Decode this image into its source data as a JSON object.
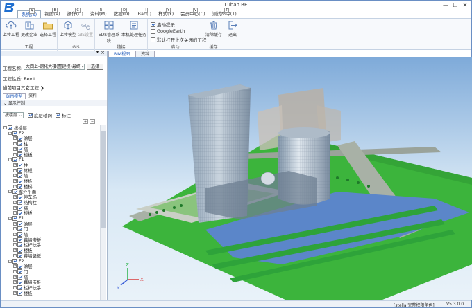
{
  "window": {
    "title": "Luban BE",
    "minimize": "—",
    "maximize": "☐",
    "close": "✕"
  },
  "menu": [
    {
      "label": "系统(S)",
      "key": "A",
      "active": true
    },
    {
      "label": "视图(V)",
      "key": "B"
    },
    {
      "label": "操作(O)",
      "key": "C"
    },
    {
      "label": "资料(M)",
      "key": "R"
    },
    {
      "label": "数据(D)",
      "key": "D"
    },
    {
      "label": "iBan(I)",
      "key": "I"
    },
    {
      "label": "样式(Y)",
      "key": "Y"
    },
    {
      "label": "会员中心(C)",
      "key": "V"
    },
    {
      "label": "测试命令(T)",
      "key": "T"
    }
  ],
  "ribbon": {
    "project": {
      "label": "工程",
      "buttons": [
        "上传工程",
        "更改企业",
        "选择工程"
      ]
    },
    "gis": {
      "label": "GIS",
      "buttons": [
        "上传模型",
        "GIS设置"
      ]
    },
    "link": {
      "label": "链接",
      "buttons": [
        "EDS管理系统",
        "本机处理任务"
      ]
    },
    "startup": {
      "label": "启动",
      "options": [
        {
          "label": "启动提示",
          "checked": true
        },
        {
          "label": "GoogleEarth",
          "checked": false
        },
        {
          "label": "默认打开上次关闭的工程",
          "checked": false
        }
      ]
    },
    "cache": {
      "label": "缓存",
      "buttons": [
        "清除缓存"
      ]
    },
    "exit": {
      "label": "",
      "buttons": [
        "退出"
      ]
    }
  },
  "left_panel": {
    "project_name_label": "工程名称:",
    "project_name_value": "大四上-钢化大楼(整建模)最终 ▾",
    "select_button": "选择",
    "project_type_label": "工程性质:",
    "project_type_value": "Revit",
    "other_projects": "当前项目其它工程 ❯",
    "tabs": [
      "BIM模型",
      "资料"
    ],
    "display_control": "⌄ 显示控制",
    "floor_dropdown": "按楼层 ⌄",
    "options": [
      {
        "label": "底层轴网",
        "checked": true
      },
      {
        "label": "标注",
        "checked": true
      }
    ],
    "pager": [
      "+",
      "−"
    ],
    "tree": [
      {
        "level": 0,
        "exp": "−",
        "label": "按楼层"
      },
      {
        "level": 1,
        "exp": "−",
        "label": "F2"
      },
      {
        "level": 2,
        "exp": "+",
        "label": "涂层"
      },
      {
        "level": 2,
        "exp": "+",
        "label": "柱"
      },
      {
        "level": 2,
        "exp": "+",
        "label": "墙"
      },
      {
        "level": 2,
        "exp": "+",
        "label": "楼板"
      },
      {
        "level": 1,
        "exp": "−",
        "label": "F1"
      },
      {
        "level": 2,
        "exp": "+",
        "label": "柱"
      },
      {
        "level": 2,
        "exp": "+",
        "label": "常规"
      },
      {
        "level": 2,
        "exp": "+",
        "label": "墙"
      },
      {
        "level": 2,
        "exp": "+",
        "label": "楼板"
      },
      {
        "level": 2,
        "exp": "+",
        "label": "楼梯"
      },
      {
        "level": 1,
        "exp": "−",
        "label": "室外平面"
      },
      {
        "level": 2,
        "exp": "+",
        "label": "停车场"
      },
      {
        "level": 2,
        "exp": "+",
        "label": "结构柱"
      },
      {
        "level": 2,
        "exp": "+",
        "label": "墙"
      },
      {
        "level": 2,
        "exp": "+",
        "label": "楼板"
      },
      {
        "level": 1,
        "exp": "−",
        "label": "F1"
      },
      {
        "level": 2,
        "exp": "+",
        "label": "涂层"
      },
      {
        "level": 2,
        "exp": "+",
        "label": "门"
      },
      {
        "level": 2,
        "exp": "+",
        "label": "墙"
      },
      {
        "level": 2,
        "exp": "+",
        "label": "幕墙嵌板"
      },
      {
        "level": 2,
        "exp": "+",
        "label": "栏杆扶手"
      },
      {
        "level": 2,
        "exp": "+",
        "label": "楼板"
      },
      {
        "level": 2,
        "exp": "+",
        "label": "幕墙竖梃"
      },
      {
        "level": 1,
        "exp": "−",
        "label": "F2"
      },
      {
        "level": 2,
        "exp": "+",
        "label": "涂层"
      },
      {
        "level": 2,
        "exp": "+",
        "label": "门"
      },
      {
        "level": 2,
        "exp": "+",
        "label": "墙"
      },
      {
        "level": 2,
        "exp": "+",
        "label": "幕墙嵌板"
      },
      {
        "level": 2,
        "exp": "+",
        "label": "栏杆扶手"
      },
      {
        "level": 2,
        "exp": "+",
        "label": "楼板"
      }
    ]
  },
  "viewport": {
    "tabs": [
      "BIM视图",
      "资料"
    ],
    "axis": {
      "x": "X",
      "y": "Y",
      "z": "Z"
    }
  },
  "status": {
    "user": "[stella,完整权限角色]",
    "version": "V5.3.0.0"
  },
  "colors": {
    "accent": "#1a56b8",
    "grass": "#3cb43c",
    "water": "#5b86c9",
    "sky_top": "#8fb8e0"
  }
}
